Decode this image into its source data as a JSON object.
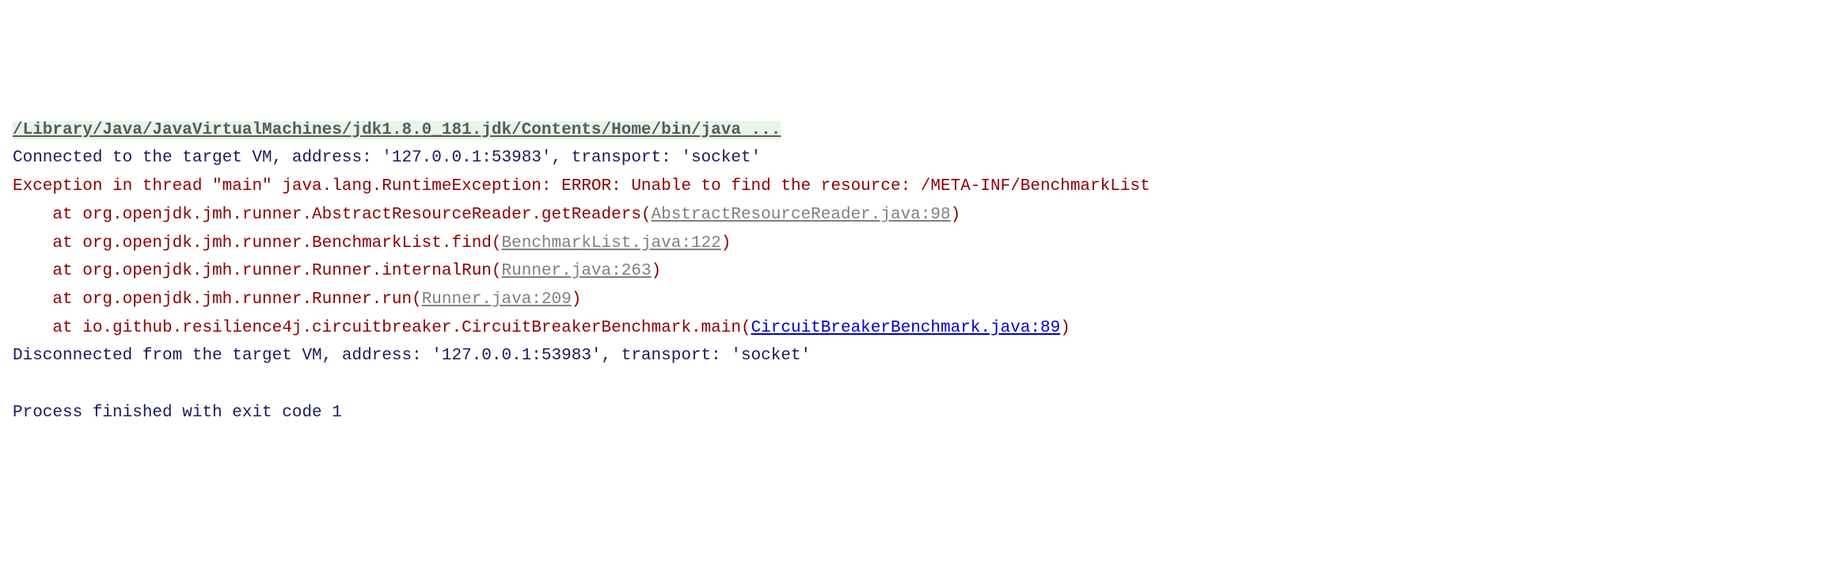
{
  "console": {
    "command": "/Library/Java/JavaVirtualMachines/jdk1.8.0_181.jdk/Contents/Home/bin/java ...",
    "connected": "Connected to the target VM, address: '127.0.0.1:53983', transport: 'socket'",
    "exception": "Exception in thread \"main\" java.lang.RuntimeException: ERROR: Unable to find the resource: /META-INF/BenchmarkList",
    "stack": [
      {
        "prefix": "    at org.openjdk.jmh.runner.AbstractResourceReader.getReaders(",
        "link": "AbstractResourceReader.java:98",
        "suffix": ")",
        "blue": false
      },
      {
        "prefix": "    at org.openjdk.jmh.runner.BenchmarkList.find(",
        "link": "BenchmarkList.java:122",
        "suffix": ")",
        "blue": false
      },
      {
        "prefix": "    at org.openjdk.jmh.runner.Runner.internalRun(",
        "link": "Runner.java:263",
        "suffix": ")",
        "blue": false
      },
      {
        "prefix": "    at org.openjdk.jmh.runner.Runner.run(",
        "link": "Runner.java:209",
        "suffix": ")",
        "blue": false
      },
      {
        "prefix": "    at io.github.resilience4j.circuitbreaker.CircuitBreakerBenchmark.main(",
        "link": "CircuitBreakerBenchmark.java:89",
        "suffix": ")",
        "blue": true
      }
    ],
    "disconnected": "Disconnected from the target VM, address: '127.0.0.1:53983', transport: 'socket'",
    "exit": "Process finished with exit code 1"
  }
}
